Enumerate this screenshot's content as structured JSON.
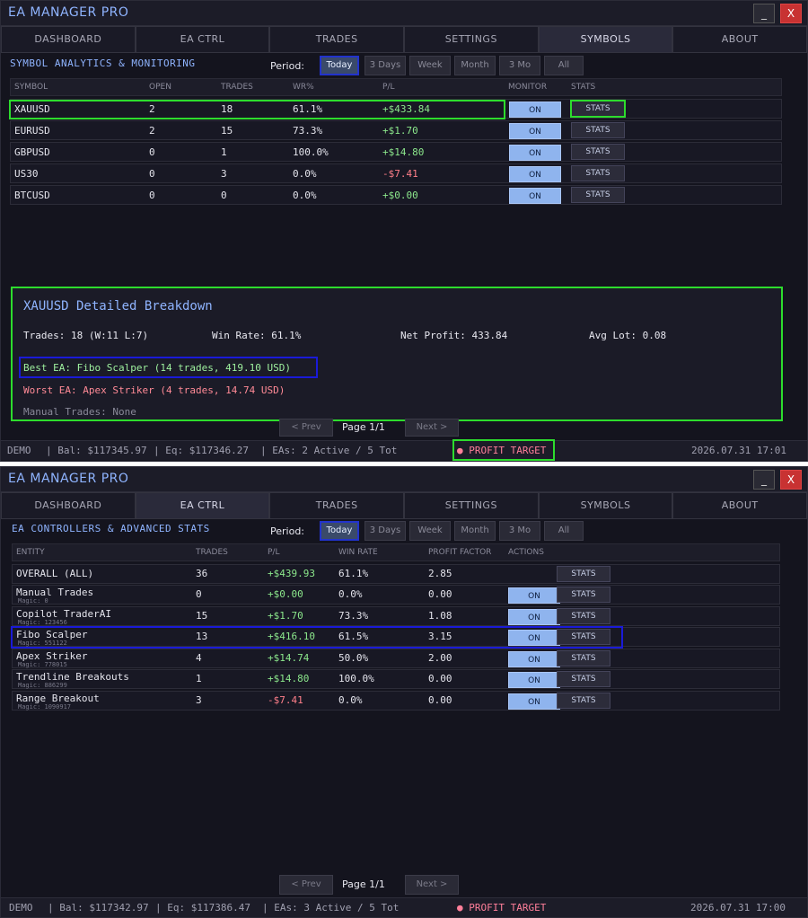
{
  "app": {
    "title": "EA MANAGER PRO",
    "minimize": "_",
    "close": "X"
  },
  "tabs": [
    "DASHBOARD",
    "EA CTRL",
    "TRADES",
    "SETTINGS",
    "SYMBOLS",
    "ABOUT"
  ],
  "period": {
    "label": "Period:",
    "options": [
      "Today",
      "3 Days",
      "Week",
      "Month",
      "3 Mo",
      "All"
    ],
    "selected": "Today"
  },
  "pager": {
    "prev": "< Prev",
    "next": "Next >",
    "page": "Page 1/1"
  },
  "symbols_view": {
    "active_tab": "SYMBOLS",
    "section_title": "SYMBOL ANALYTICS & MONITORING",
    "headers": [
      "SYMBOL",
      "OPEN",
      "TRADES",
      "WR%",
      "P/L",
      "MONITOR",
      "STATS"
    ],
    "rows": [
      {
        "symbol": "XAUUSD",
        "open": "2",
        "trades": "18",
        "wr": "61.1%",
        "pl": "+$433.84",
        "monitor": "ON",
        "stats": "STATS"
      },
      {
        "symbol": "EURUSD",
        "open": "2",
        "trades": "15",
        "wr": "73.3%",
        "pl": "+$1.70",
        "monitor": "ON",
        "stats": "STATS"
      },
      {
        "symbol": "GBPUSD",
        "open": "0",
        "trades": "1",
        "wr": "100.0%",
        "pl": "+$14.80",
        "monitor": "ON",
        "stats": "STATS"
      },
      {
        "symbol": "US30",
        "open": "0",
        "trades": "3",
        "wr": "0.0%",
        "pl": "-$7.41",
        "monitor": "ON",
        "stats": "STATS"
      },
      {
        "symbol": "BTCUSD",
        "open": "0",
        "trades": "0",
        "wr": "0.0%",
        "pl": "+$0.00",
        "monitor": "ON",
        "stats": "STATS"
      }
    ],
    "breakdown": {
      "title": "XAUUSD Detailed Breakdown",
      "trades": "Trades: 18 (W:11 L:7)",
      "win_rate": "Win Rate: 61.1%",
      "net_profit": "Net Profit: 433.84",
      "avg_lot": "Avg Lot: 0.08",
      "best_ea": "Best EA: Fibo Scalper (14 trades, 419.10 USD)",
      "worst_ea": "Worst EA: Apex Striker (4 trades, 14.74 USD)",
      "manual": "Manual Trades: None"
    },
    "status": {
      "mode": "DEMO",
      "balance": "| Bal: $117345.97",
      "equity": "| Eq: $117346.27",
      "eas": "| EAs: 2 Active / 5 Tot",
      "alert": "● PROFIT TARGET",
      "datetime": "2026.07.31 17:01"
    }
  },
  "ea_view": {
    "active_tab": "EA CTRL",
    "section_title": "EA CONTROLLERS & ADVANCED STATS",
    "headers": [
      "ENTITY",
      "TRADES",
      "P/L",
      "WIN RATE",
      "PROFIT FACTOR",
      "ACTIONS"
    ],
    "rows": [
      {
        "name": "OVERALL (ALL)",
        "magic": "",
        "trades": "36",
        "pl": "+$439.93",
        "wr": "61.1%",
        "pf": "2.85",
        "on": "",
        "stats": "STATS"
      },
      {
        "name": "Manual Trades",
        "magic": "Magic: 0",
        "trades": "0",
        "pl": "+$0.00",
        "wr": "0.0%",
        "pf": "0.00",
        "on": "ON",
        "stats": "STATS"
      },
      {
        "name": "Copilot TraderAI",
        "magic": "Magic: 123456",
        "trades": "15",
        "pl": "+$1.70",
        "wr": "73.3%",
        "pf": "1.08",
        "on": "ON",
        "stats": "STATS"
      },
      {
        "name": "Fibo Scalper",
        "magic": "Magic: 551122",
        "trades": "13",
        "pl": "+$416.10",
        "wr": "61.5%",
        "pf": "3.15",
        "on": "ON",
        "stats": "STATS"
      },
      {
        "name": "Apex Striker",
        "magic": "Magic: 778015",
        "trades": "4",
        "pl": "+$14.74",
        "wr": "50.0%",
        "pf": "2.00",
        "on": "ON",
        "stats": "STATS"
      },
      {
        "name": "Trendline Breakouts",
        "magic": "Magic: 886299",
        "trades": "1",
        "pl": "+$14.80",
        "wr": "100.0%",
        "pf": "0.00",
        "on": "ON",
        "stats": "STATS"
      },
      {
        "name": "Range Breakout",
        "magic": "Magic: 1090917",
        "trades": "3",
        "pl": "-$7.41",
        "wr": "0.0%",
        "pf": "0.00",
        "on": "ON",
        "stats": "STATS"
      }
    ],
    "status": {
      "mode": "DEMO",
      "balance": "| Bal: $117342.97",
      "equity": "| Eq: $117386.47",
      "eas": "| EAs: 3 Active / 5 Tot",
      "alert": "● PROFIT TARGET",
      "datetime": "2026.07.31 17:00"
    }
  },
  "colors": {
    "accent": "#8fb4ff",
    "profit": "#8ce88c",
    "loss": "#ff7f8a",
    "highlight_green": "#2ddc2d",
    "highlight_blue": "#1a1ad8"
  }
}
